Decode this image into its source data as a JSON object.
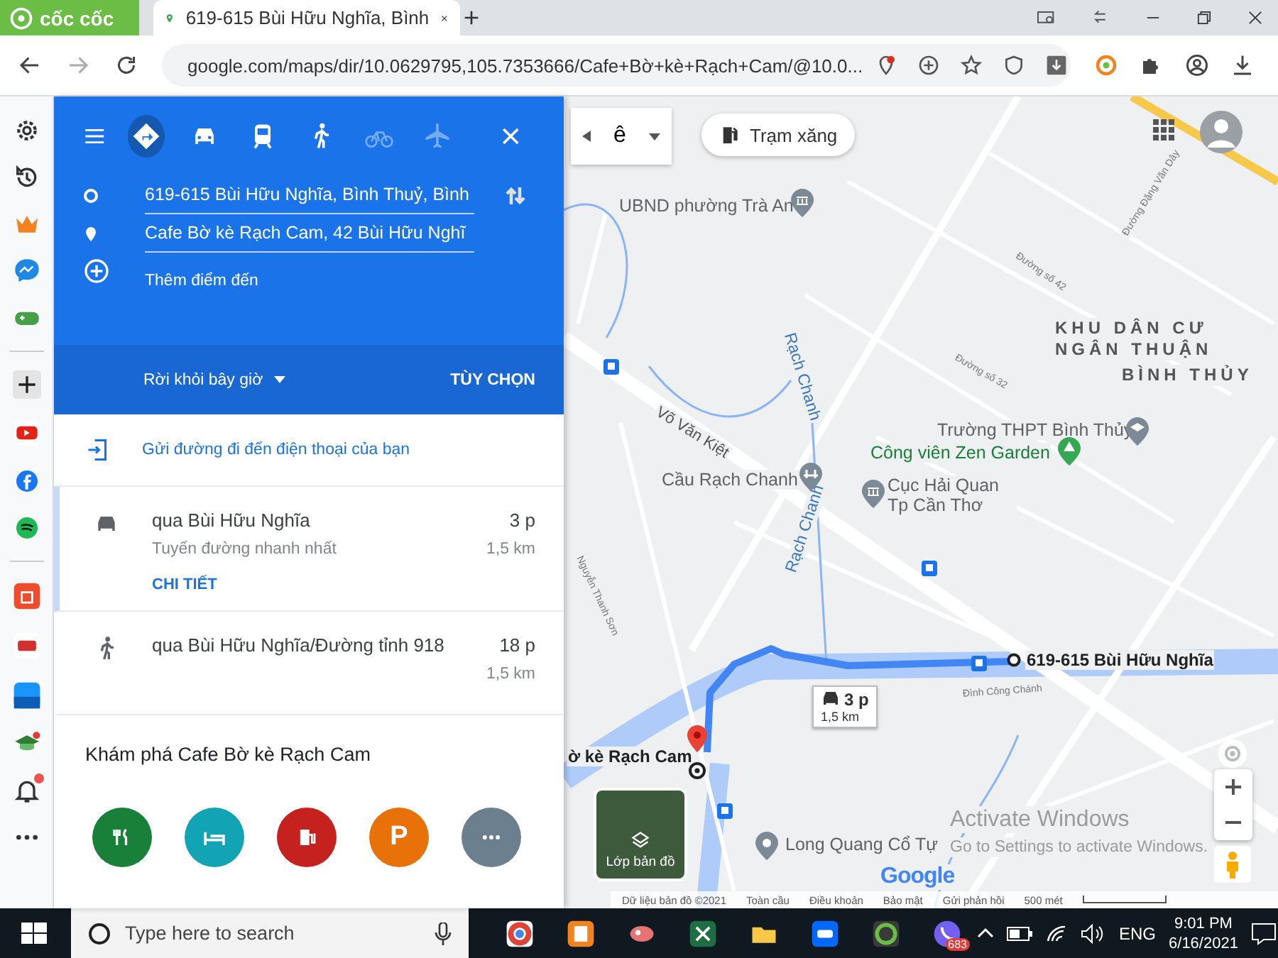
{
  "browser": {
    "brand": "cốc cốc",
    "tab_title": "619-615 Bùi Hữu Nghĩa, Bình",
    "url": "google.com/maps/dir/10.0629795,105.7353666/Cafe+Bờ+kè+Rạch+Cam/@10.0..."
  },
  "directions": {
    "modes": [
      {
        "kind": "best",
        "selected": true,
        "disabled": false
      },
      {
        "kind": "car",
        "selected": false,
        "disabled": false
      },
      {
        "kind": "transit",
        "selected": false,
        "disabled": false
      },
      {
        "kind": "walk",
        "selected": false,
        "disabled": false
      },
      {
        "kind": "bike",
        "selected": false,
        "disabled": true
      },
      {
        "kind": "flight",
        "selected": false,
        "disabled": true
      }
    ],
    "origin": "619-615 Bùi Hữu Nghĩa, Bình Thuỷ, Bình",
    "destination": "Cafe Bờ kè Rạch Cam, 42 Bùi Hữu Nghĩ",
    "add_stop": "Thêm điểm đến",
    "depart": "Rời khỏi bây giờ",
    "options": "TÙY CHỌN"
  },
  "send_to_phone": "Gửi đường đi đến điện thoại của bạn",
  "routes": [
    {
      "kind": "car",
      "selected": true,
      "title": "qua Bùi Hữu Nghĩa",
      "time": "3 p",
      "subtitle": "Tuyến đường nhanh nhất",
      "distance": "1,5 km",
      "details": "CHI TIẾT"
    },
    {
      "kind": "walk",
      "selected": false,
      "title": "qua Bùi Hữu Nghĩa/Đường tỉnh 918",
      "time": "18 p",
      "distance": "1,5 km"
    }
  ],
  "explore": {
    "title": "Khám phá Cafe Bờ kè Rạch Cam",
    "categories": [
      {
        "kind": "restaurant",
        "color": "#188038"
      },
      {
        "kind": "hotel",
        "color": "#12a4b4"
      },
      {
        "kind": "gas",
        "color": "#c5221f"
      },
      {
        "kind": "parking",
        "color": "#e8710a",
        "label": "P"
      },
      {
        "kind": "more",
        "color": "#6c7f8e"
      }
    ]
  },
  "map": {
    "mode_value": "ê",
    "chip": "Trạm xăng",
    "labels": [
      {
        "kind": "poi",
        "text": "UBND phường Trà An"
      },
      {
        "kind": "street",
        "text": "Võ Văn Kiệt"
      },
      {
        "kind": "water",
        "text": "Rạch Chanh"
      },
      {
        "kind": "area",
        "text": "KHU DÂN CƯ NGÂN THUẬN"
      },
      {
        "kind": "area",
        "text": "BÌNH THỦY"
      },
      {
        "kind": "poi",
        "text": "Trường THPT Bình Thủy"
      },
      {
        "kind": "park",
        "text": "Công viên Zen Garden"
      },
      {
        "kind": "poi",
        "text": "Cầu Rạch Chanh"
      },
      {
        "kind": "poi",
        "text": "Cục Hải Quan Tp Cần Thơ"
      },
      {
        "kind": "water",
        "text": "Rạch Chanh"
      },
      {
        "kind": "small",
        "text": "Đình Công Chánh"
      },
      {
        "kind": "poi",
        "text": "Long Quang Cổ Tự"
      },
      {
        "kind": "small",
        "text": "Đường số 42"
      },
      {
        "kind": "small",
        "text": "Đường số 32"
      },
      {
        "kind": "small",
        "text": "Đường Đặng Văn Dây"
      },
      {
        "kind": "small",
        "text": "Nguyễn Thanh Sơn"
      },
      {
        "kind": "endpoint",
        "text": "ờ kè Rạch Cam"
      },
      {
        "kind": "endpoint",
        "text": "619-615 Bùi Hữu Nghĩa"
      }
    ],
    "route_time": "3 p",
    "route_distance": "1,5 km",
    "layers": "Lớp bản đồ",
    "logo": "Google",
    "footer": [
      "Dữ liệu bản đồ ©2021",
      "Toàn cầu",
      "Điều khoản",
      "Bảo mật",
      "Gửi phản hồi"
    ],
    "scale": "500 mét",
    "activation_title": "Activate Windows",
    "activation_text": "Go to Settings to activate Windows."
  },
  "taskbar": {
    "search_placeholder": "Type here to search",
    "app_badge": "683",
    "language": "ENG",
    "time": "9:01 PM",
    "date": "6/16/2021"
  }
}
